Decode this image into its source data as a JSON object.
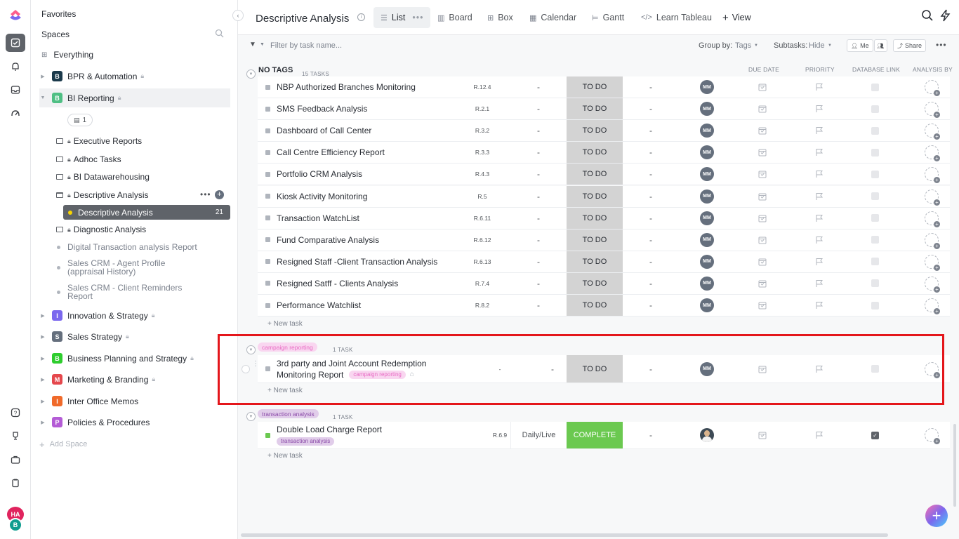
{
  "sidebar": {
    "favorites": "Favorites",
    "spaces": "Spaces",
    "everything": "Everything",
    "spaces_list": [
      {
        "badge": "B",
        "name": "BPR & Automation",
        "color": "#1b3a4b"
      },
      {
        "badge": "B",
        "name": "BI Reporting",
        "color": "#4fbf84"
      },
      {
        "badge": "I",
        "name": "Innovation & Strategy",
        "color": "#7b68ee"
      },
      {
        "badge": "S",
        "name": "Sales Strategy",
        "color": "#656f7d"
      },
      {
        "badge": "B",
        "name": "Business Planning and Strategy",
        "color": "#2ecd2e"
      },
      {
        "badge": "M",
        "name": "Marketing & Branding",
        "color": "#e5484d"
      },
      {
        "badge": "I",
        "name": "Inter Office Memos",
        "color": "#f06a2a"
      },
      {
        "badge": "P",
        "name": "Policies & Procedures",
        "color": "#b45cd6"
      }
    ],
    "doc_count": "1",
    "folders": [
      "Executive Reports",
      "Adhoc Tasks",
      "BI Datawarehousing",
      "Descriptive Analysis",
      "Diagnostic Analysis"
    ],
    "selected_list": "Descriptive Analysis",
    "selected_list_count": "21",
    "lists": [
      "Digital Transaction analysis Report",
      "Sales CRM - Agent Profile (appraisal History)",
      "Sales CRM - Client Reminders Report"
    ],
    "add_space": "Add Space"
  },
  "rail": {
    "avatar1": "HA",
    "avatar2": "B"
  },
  "header": {
    "title": "Descriptive Analysis",
    "tabs": [
      "List",
      "Board",
      "Box",
      "Calendar",
      "Gantt",
      "Learn Tableau"
    ],
    "add_view": "View"
  },
  "filterbar": {
    "placeholder": "Filter by task name...",
    "group_by_label": "Group by:",
    "group_by_value": "Tags",
    "subtasks_label": "Subtasks:",
    "subtasks_value": "Hide",
    "me": "Me",
    "share": "Share"
  },
  "columns": {
    "due_date": "DUE DATE",
    "priority": "PRIORITY",
    "database_link": "DATABASE LINK",
    "analysis_by": "ANALYSIS BY"
  },
  "groups": [
    {
      "title": "NO TAGS",
      "count": "15 TASKS",
      "tasks": [
        {
          "name": "NBP Authorized Branches Monitoring",
          "code": "R.12.4",
          "freq": "-",
          "status": "TO DO",
          "col4": "-",
          "assignee": "MM"
        },
        {
          "name": "SMS Feedback Analysis",
          "code": "R.2.1",
          "freq": "-",
          "status": "TO DO",
          "col4": "-",
          "assignee": "MM"
        },
        {
          "name": "Dashboard of Call Center",
          "code": "R.3.2",
          "freq": "-",
          "status": "TO DO",
          "col4": "-",
          "assignee": "MM"
        },
        {
          "name": "Call Centre Efficiency Report",
          "code": "R.3.3",
          "freq": "-",
          "status": "TO DO",
          "col4": "-",
          "assignee": "MM"
        },
        {
          "name": "Portfolio CRM Analysis",
          "code": "R.4.3",
          "freq": "-",
          "status": "TO DO",
          "col4": "-",
          "assignee": "MM"
        },
        {
          "name": "Kiosk Activity Monitoring",
          "code": "R.5",
          "freq": "-",
          "status": "TO DO",
          "col4": "-",
          "assignee": "MM"
        },
        {
          "name": "Transaction WatchList",
          "code": "R.6.11",
          "freq": "-",
          "status": "TO DO",
          "col4": "-",
          "assignee": "MM"
        },
        {
          "name": "Fund Comparative Analysis",
          "code": "R.6.12",
          "freq": "-",
          "status": "TO DO",
          "col4": "-",
          "assignee": "MM"
        },
        {
          "name": "Resigned Staff -Client Transaction Analysis",
          "code": "R.6.13",
          "freq": "-",
          "status": "TO DO",
          "col4": "-",
          "assignee": "MM"
        },
        {
          "name": "Resigned Satff - Clients Analysis",
          "code": "R.7.4",
          "freq": "-",
          "status": "TO DO",
          "col4": "-",
          "assignee": "MM"
        },
        {
          "name": "Performance Watchlist",
          "code": "R.8.2",
          "freq": "-",
          "status": "TO DO",
          "col4": "-",
          "assignee": "MM"
        }
      ]
    },
    {
      "title": "campaign reporting",
      "count": "1 TASK",
      "tasks": [
        {
          "name_line1": "3rd party and Joint Account Redemption",
          "name_line2": "Monitoring Report",
          "tag": "campaign reporting",
          "code": "-",
          "freq": "-",
          "status": "TO DO",
          "col4": "-",
          "assignee": "MM"
        }
      ]
    },
    {
      "title": "transaction analysis",
      "count": "1 TASK",
      "tasks": [
        {
          "name": "Double Load Charge Report",
          "tag": "transaction analysis",
          "code": "R.6.9",
          "freq": "Daily/Live",
          "status": "COMPLETE",
          "col4": "-"
        }
      ]
    }
  ],
  "new_task": "+ New task",
  "colors": {
    "todo": "#d3d3d3",
    "complete": "#6bc950",
    "highlight": "#e4161b",
    "pink_tag": "#f9d6f0",
    "purple_tag": "#e1cdea"
  }
}
